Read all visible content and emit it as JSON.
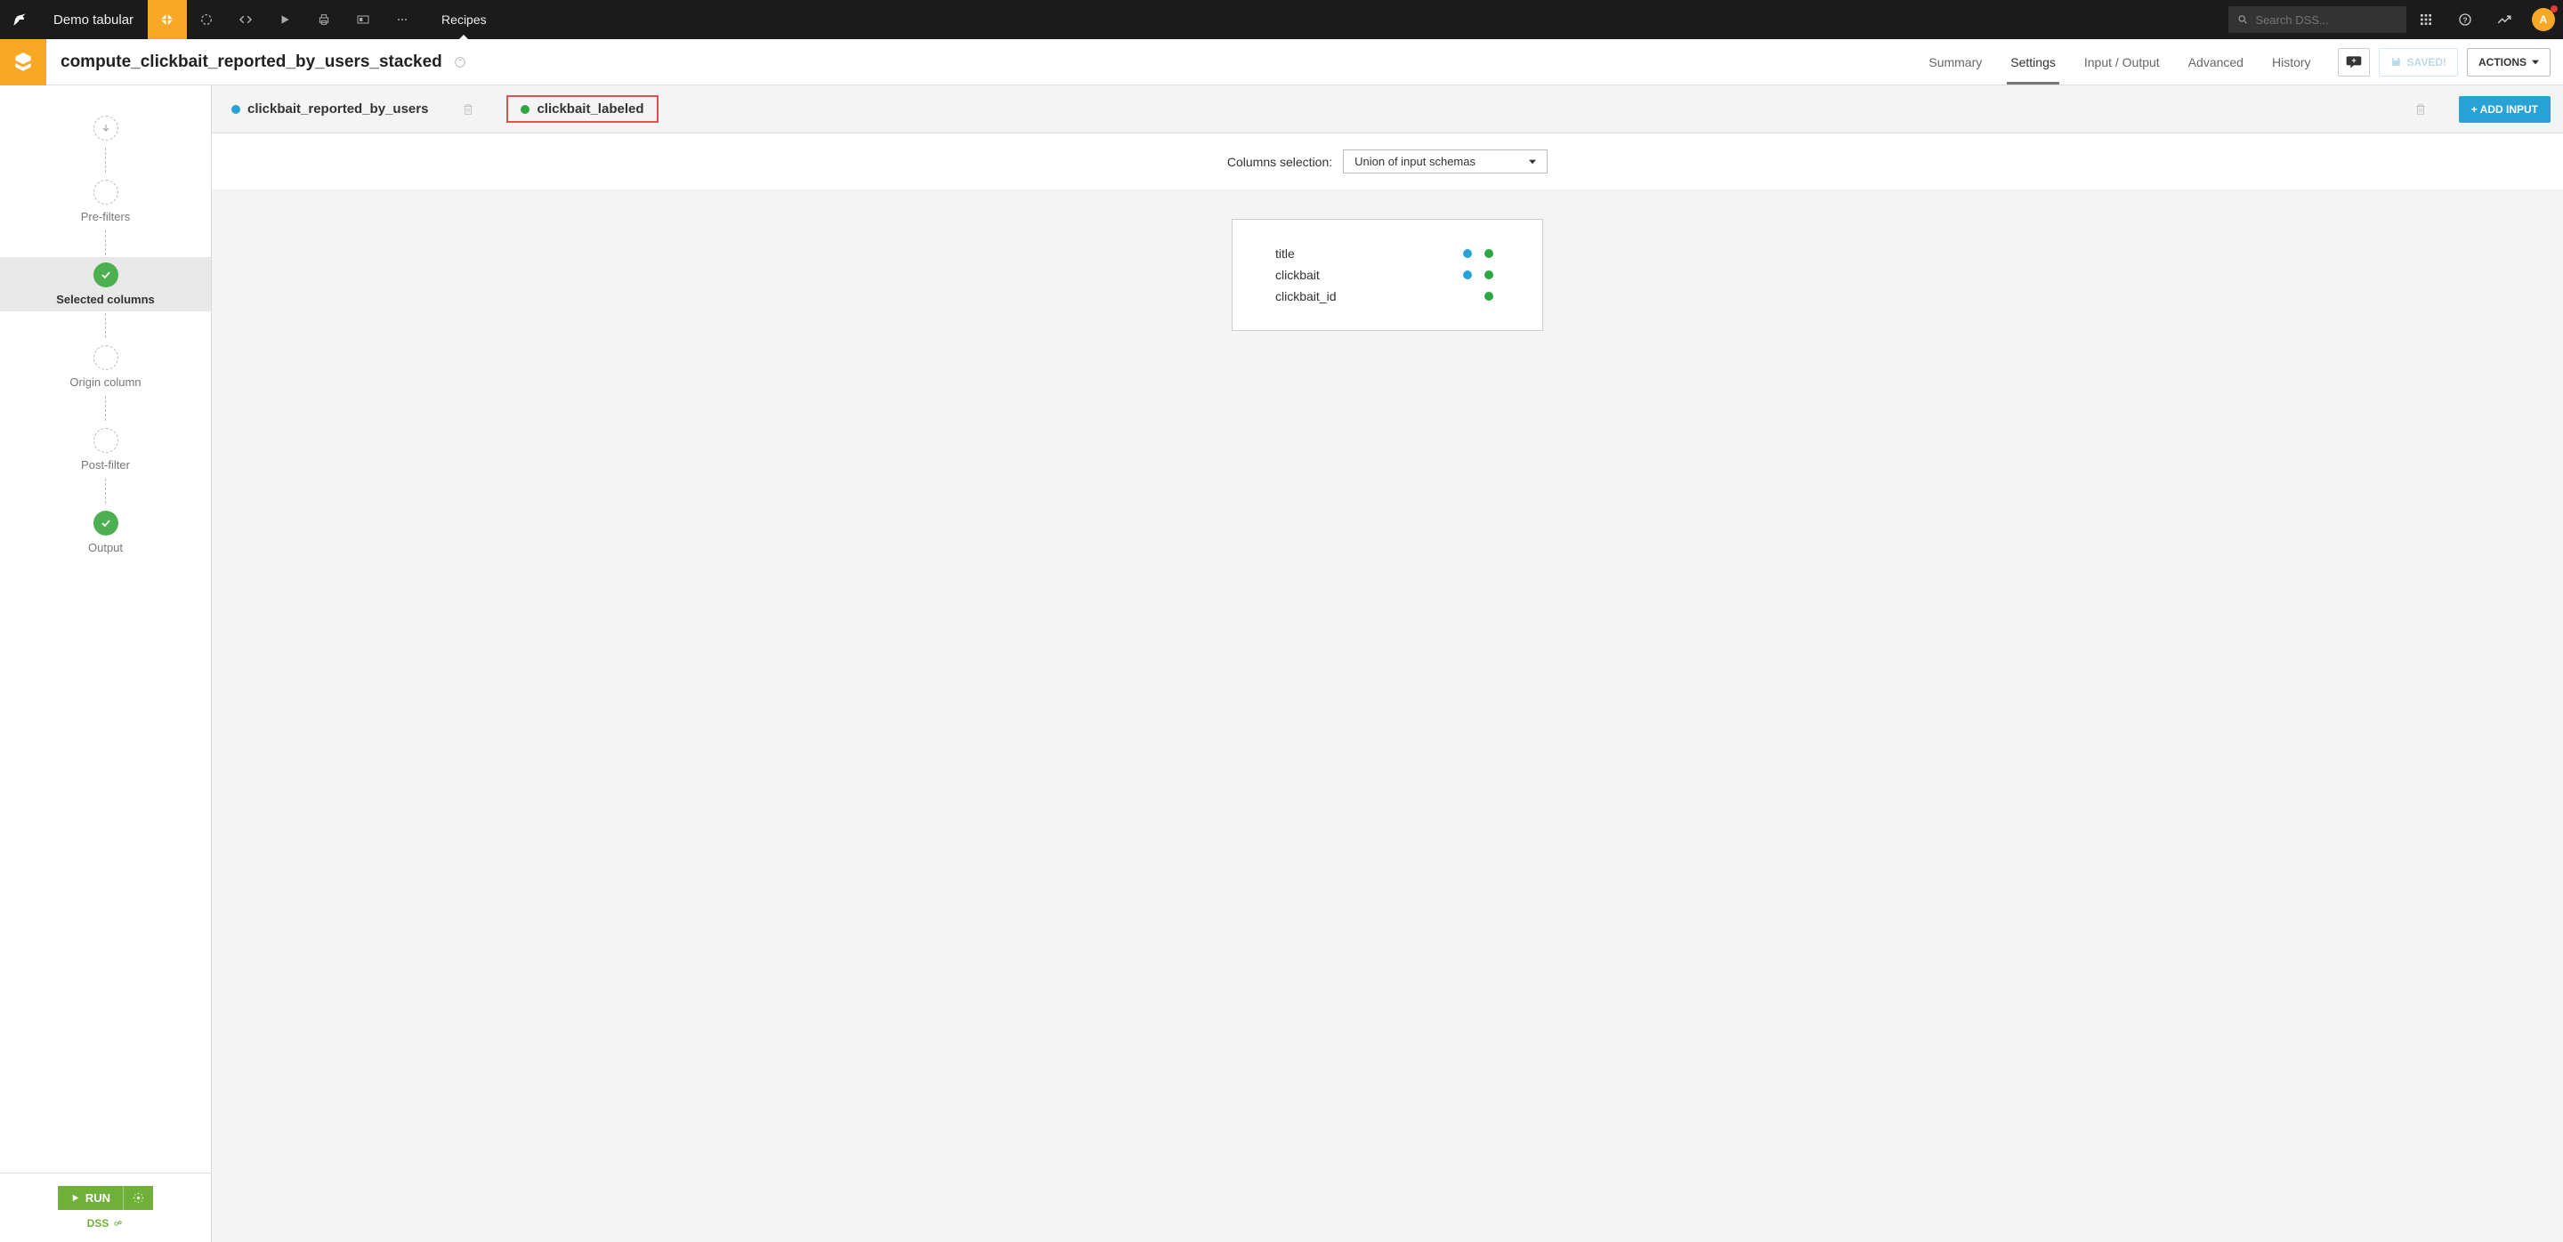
{
  "nav": {
    "project_name": "Demo tabular",
    "tab": "Recipes",
    "search_placeholder": "Search DSS...",
    "avatar_letter": "A"
  },
  "title": {
    "recipe_name": "compute_clickbait_reported_by_users_stacked",
    "tabs": [
      "Summary",
      "Settings",
      "Input / Output",
      "Advanced",
      "History"
    ],
    "active_tab": "Settings",
    "saved_label": "SAVED!",
    "actions_label": "ACTIONS"
  },
  "steps": {
    "prefilters": "Pre-filters",
    "selected": "Selected columns",
    "origin": "Origin column",
    "postfilter": "Post-filter",
    "output": "Output"
  },
  "run": {
    "label": "RUN",
    "engine": "DSS"
  },
  "inputs": {
    "ds1": "clickbait_reported_by_users",
    "ds2": "clickbait_labeled",
    "add": "+ ADD INPUT"
  },
  "selection": {
    "label": "Columns selection:",
    "value": "Union of input schemas"
  },
  "columns": {
    "rows": [
      {
        "name": "title",
        "in1": true,
        "in2": true
      },
      {
        "name": "clickbait",
        "in1": true,
        "in2": true
      },
      {
        "name": "clickbait_id",
        "in1": false,
        "in2": true
      }
    ]
  }
}
